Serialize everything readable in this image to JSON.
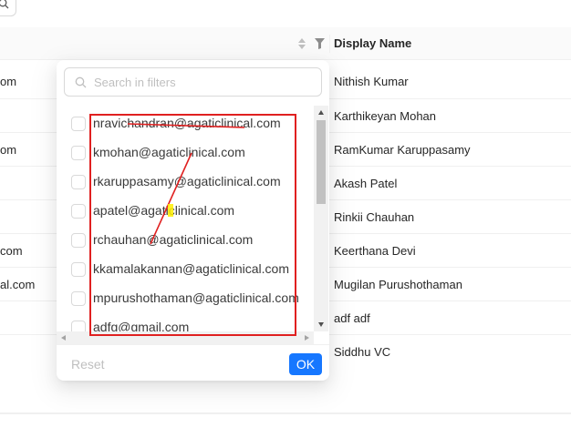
{
  "table": {
    "header": {
      "display_name": "Display Name"
    },
    "rows": [
      {
        "email": "om",
        "name": "Nithish Kumar"
      },
      {
        "email": "",
        "name": "Karthikeyan Mohan"
      },
      {
        "email": "om",
        "name": "RamKumar Karuppasamy"
      },
      {
        "email": "",
        "name": "Akash Patel"
      },
      {
        "email": "",
        "name": "Rinkii Chauhan"
      },
      {
        "email": "com",
        "name": "Keerthana Devi"
      },
      {
        "email": "al.com",
        "name": "Mugilan Purushothaman"
      },
      {
        "email": "",
        "name": "adf adf"
      },
      {
        "email": "",
        "name": "Siddhu VC"
      }
    ]
  },
  "filter": {
    "search_placeholder": "Search in filters",
    "items": [
      "nravichandran@agaticlinical.com",
      "kmohan@agaticlinical.com",
      "rkaruppasamy@agaticlinical.com",
      "apatel@agaticlinical.com",
      "rchauhan@agaticlinical.com",
      "kkamalakannan@agaticlinical.com",
      "mpurushothaman@agaticlinical.com",
      "adfg@gmail.com"
    ],
    "reset_label": "Reset",
    "ok_label": "OK"
  },
  "colors": {
    "primary": "#1677ff",
    "annotation": "#e02020",
    "highlight": "#ffee00"
  }
}
